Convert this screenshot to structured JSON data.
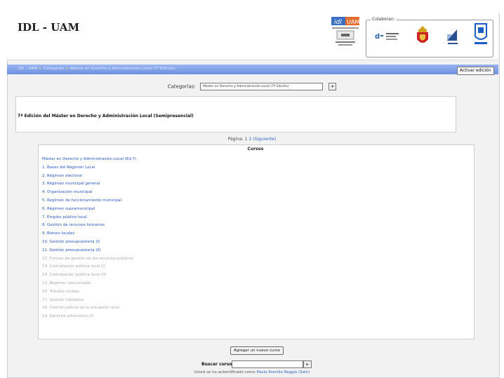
{
  "header": {
    "site_title": "IDL - UAM",
    "collab_legend": "Colaboran:",
    "logo_idl_text": "idl",
    "logo_uam_text": "UAM"
  },
  "navbar": {
    "breadcrumbs": [
      "IDL - UAM",
      "Categorías",
      "Máster en Derecho y Administración Local (7ª Edición)"
    ],
    "edit_button": "Activar edición"
  },
  "category": {
    "label": "Categorías:",
    "selected": "Máster en Derecho y Administración Local (7ª Edición)"
  },
  "description": {
    "text": "7ª Edición del Máster en Derecho y Administración Local (Semipresencial)"
  },
  "paging": {
    "label": "Página:",
    "page1": "1",
    "page2": "2",
    "next": "(Siguiente)"
  },
  "courses": {
    "title": "Cursos",
    "items": [
      {
        "label": "Máster en Derecho y Administración Local (Ed.7)",
        "visible": true
      },
      {
        "label": "1. Bases del Régimen Local",
        "visible": true
      },
      {
        "label": "2. Régimen electoral",
        "visible": true
      },
      {
        "label": "3. Régimen municipal general",
        "visible": true
      },
      {
        "label": "4. Organización municipal",
        "visible": true
      },
      {
        "label": "5. Régimen de funcionamiento municipal",
        "visible": true
      },
      {
        "label": "6. Régimen supramunicipal",
        "visible": true
      },
      {
        "label": "7. Empleo público local",
        "visible": true
      },
      {
        "label": "8. Gestión de recursos humanos",
        "visible": true
      },
      {
        "label": "9. Bienes locales",
        "visible": true
      },
      {
        "label": "10. Gestión presupuestaria (I)",
        "visible": true
      },
      {
        "label": "11. Gestión presupuestaria (II)",
        "visible": true
      },
      {
        "label": "12. Formas de gestión de los servicios públicos",
        "visible": false
      },
      {
        "label": "13. Contratación pública local (I)",
        "visible": false
      },
      {
        "label": "14. Contratación pública local (II)",
        "visible": false
      },
      {
        "label": "15. Régimen sancionador",
        "visible": false
      },
      {
        "label": "16. Tributos locales",
        "visible": false
      },
      {
        "label": "17. Gestión tributaria",
        "visible": false
      },
      {
        "label": "18. Control judicial de la actuación local",
        "visible": false
      },
      {
        "label": "19. Derecho urbanístico (I)",
        "visible": false
      }
    ]
  },
  "actions": {
    "add_course": "Agregar un nuevo curso"
  },
  "search": {
    "label": "Buscar cursos:",
    "value": "",
    "go_symbol": "▸"
  },
  "footer": {
    "prefix": "Usted se ha autentificado como",
    "user": "Paula Arenilla Reggio",
    "logout": "(Salir)"
  }
}
